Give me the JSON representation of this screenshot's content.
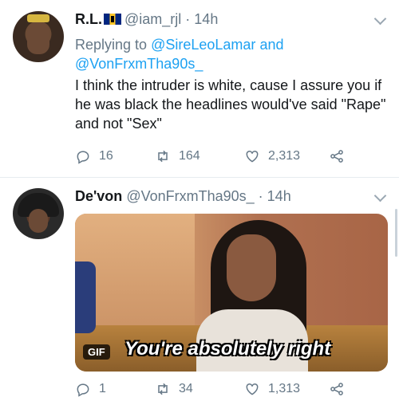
{
  "tweets": [
    {
      "name": "R.L.",
      "handle": "@iam_rjl",
      "time": "· 14h",
      "replying_prefix": "Replying to",
      "replying_user1": "@SireLeoLamar",
      "replying_and": "and",
      "replying_user2": "@VonFrxmTha90s_",
      "text": "I think the intruder is white, cause I assure you if he was black the headlines would've said \"Rape\" and not \"Sex\"",
      "replies": "16",
      "retweets": "164",
      "likes": "2,313"
    },
    {
      "name": "De'von",
      "handle": "@VonFrxmTha90s_",
      "time": "· 14h",
      "gif_badge": "GIF",
      "gif_caption": "You're absolutely right",
      "replies": "1",
      "retweets": "34",
      "likes": "1,313"
    }
  ],
  "colors": {
    "link": "#1da1f2",
    "meta": "#657786",
    "text": "#14171a"
  },
  "icons": [
    "reply-icon",
    "retweet-icon",
    "like-icon",
    "share-icon",
    "chevron-down-icon"
  ]
}
